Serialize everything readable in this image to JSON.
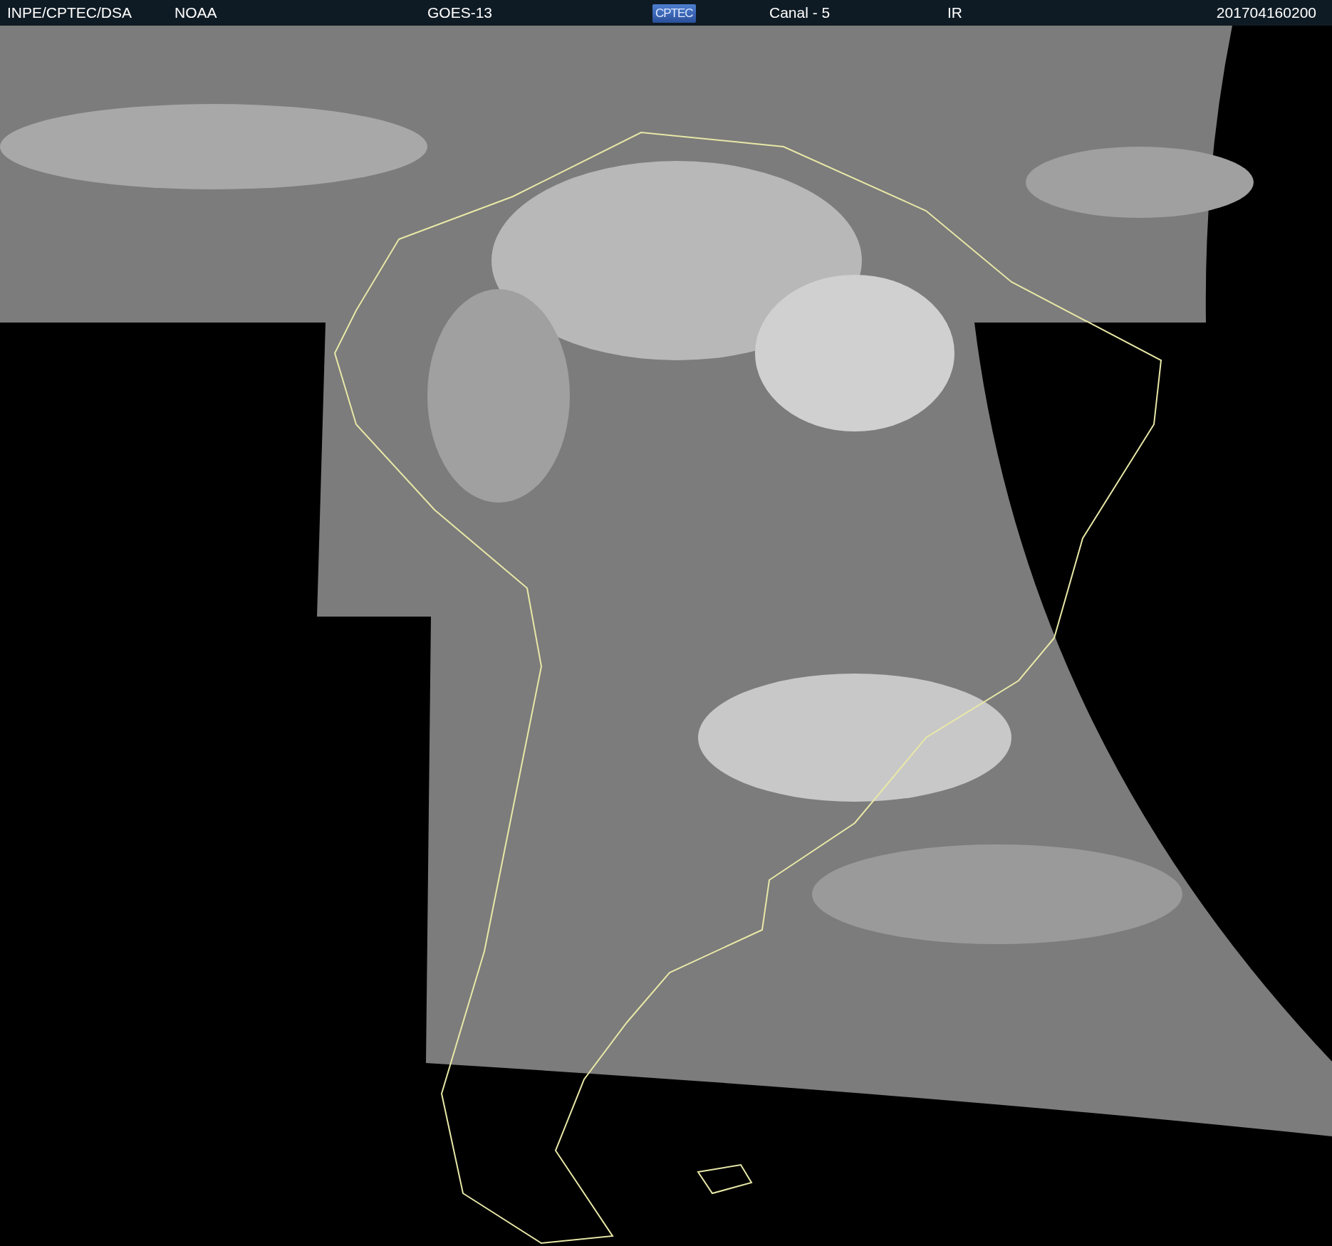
{
  "header": {
    "source": "INPE/CPTEC/DSA",
    "agency": "NOAA",
    "satellite": "GOES-13",
    "logo": "CPTEC",
    "channel": "Canal - 5",
    "band": "IR",
    "timestamp": "201704160200"
  }
}
